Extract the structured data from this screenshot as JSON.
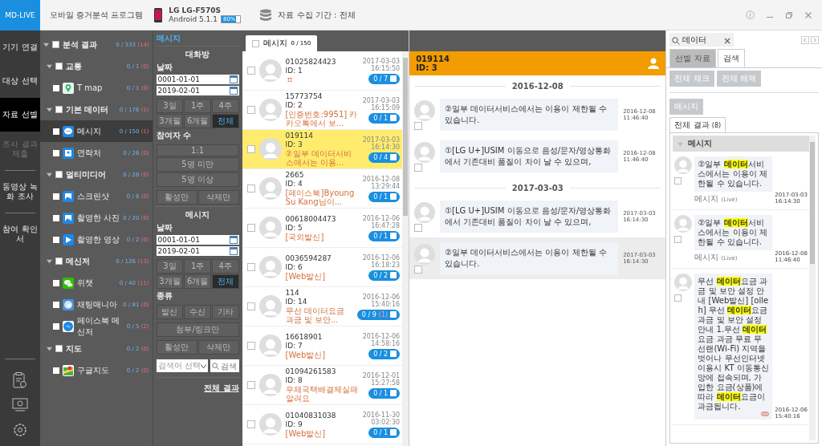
{
  "header": {
    "logo": "MD-LIVE",
    "title": "모바일 증거분석 프로그램",
    "device_name": "LG LG-F570S",
    "os": "Android 5.1.1",
    "battery": "80%",
    "period": "자료 수집 기간 : 전체"
  },
  "nav": {
    "steps": [
      {
        "label": "기기 연결",
        "selected": false,
        "disabled": false
      },
      {
        "label": "대상 선택",
        "selected": false,
        "disabled": false
      },
      {
        "label": "자료 선별",
        "selected": true,
        "disabled": false
      },
      {
        "label": "조사 결과 제출",
        "selected": false,
        "disabled": true
      }
    ],
    "tools": [
      "동영상 녹화 조사",
      "참여 확인서"
    ]
  },
  "tree": {
    "label": "분석 결과",
    "count": "0 / 333",
    "flag": "(14)",
    "expanded": true,
    "checked": false,
    "children": [
      {
        "label": "교통",
        "count": "0 / 1",
        "flag": "(0)",
        "expanded": true,
        "checked": false,
        "children": [
          {
            "label": "T map",
            "count": "0 / 1",
            "flag": "(0)",
            "kind": "pin",
            "selected": false
          }
        ]
      },
      {
        "label": "기본 데이터",
        "count": "0 / 176",
        "flag": "(1)",
        "expanded": true,
        "checked": false,
        "children": [
          {
            "label": "메시지",
            "count": "0 / 150",
            "flag": "(1)",
            "kind": "chat",
            "selected": true
          },
          {
            "label": "연락처",
            "count": "0 / 26",
            "flag": "(0)",
            "kind": "contact",
            "selected": false
          }
        ]
      },
      {
        "label": "멀티미디어",
        "count": "0 / 28",
        "flag": "(0)",
        "expanded": true,
        "checked": false,
        "children": [
          {
            "label": "스크린샷",
            "count": "0 / 6",
            "flag": "(0)",
            "kind": "image",
            "selected": false
          },
          {
            "label": "촬영한 사진",
            "count": "0 / 20",
            "flag": "(0)",
            "kind": "image",
            "selected": false
          },
          {
            "label": "촬영한 영상",
            "count": "0 / 2",
            "flag": "(0)",
            "kind": "play",
            "selected": false
          }
        ]
      },
      {
        "label": "메신저",
        "count": "0 / 126",
        "flag": "(13)",
        "expanded": true,
        "checked": false,
        "children": [
          {
            "label": "위챗",
            "count": "0 / 40",
            "flag": "(11)",
            "kind": "wechat",
            "selected": false
          },
          {
            "label": "채팅매니아",
            "count": "0 / 81",
            "flag": "(0)",
            "kind": "bubble",
            "selected": false
          },
          {
            "label": "페이스북 메신저",
            "count": "0 / 5",
            "flag": "(2)",
            "kind": "messenger",
            "selected": false
          }
        ]
      },
      {
        "label": "지도",
        "count": "0 / 2",
        "flag": "(0)",
        "expanded": true,
        "checked": false,
        "children": [
          {
            "label": "구글지도",
            "count": "0 / 2",
            "flag": "(0)",
            "kind": "map",
            "selected": false
          }
        ]
      }
    ]
  },
  "filter": {
    "title": "메시지",
    "sections": [
      {
        "heading": "대화방",
        "date_label": "날짜",
        "date_from": "0001-01-01",
        "date_to": "2019-02-01",
        "ranges": [
          {
            "label": "3일",
            "selected": false
          },
          {
            "label": "1주",
            "selected": false
          },
          {
            "label": "4주",
            "selected": false
          },
          {
            "label": "3개월",
            "selected": false
          },
          {
            "label": "6개월",
            "selected": false
          },
          {
            "label": "전체",
            "selected": true
          }
        ],
        "blocks": [
          {
            "label": "참여자 수",
            "rows": [
              [
                "1:1"
              ],
              [
                "5명 미만"
              ],
              [
                "5명 이상"
              ]
            ]
          },
          {
            "rows": [
              [
                "활성만",
                "삭제만"
              ]
            ]
          }
        ]
      },
      {
        "heading": "메시지",
        "date_label": "날짜",
        "date_from": "0001-01-01",
        "date_to": "2019-02-01",
        "ranges": [
          {
            "label": "3일",
            "selected": false
          },
          {
            "label": "1주",
            "selected": false
          },
          {
            "label": "4주",
            "selected": false
          },
          {
            "label": "3개월",
            "selected": false
          },
          {
            "label": "6개월",
            "selected": false
          },
          {
            "label": "전체",
            "selected": true
          }
        ],
        "blocks": [
          {
            "label": "종류",
            "rows": [
              [
                "발신",
                "수신",
                "기타"
              ]
            ]
          },
          {
            "rows": [
              [
                "첨부/링크만"
              ]
            ]
          },
          {
            "rows": [
              [
                "활성만",
                "삭제만"
              ]
            ]
          }
        ]
      }
    ],
    "keyword_select": "검색어 선택",
    "search_placeholder": "검색",
    "all_results": "전체 결과"
  },
  "list": {
    "tab": {
      "label": "메시지",
      "count": "0 / 150",
      "checked": false
    },
    "rows": [
      {
        "number": "01025824423",
        "id": "ID: 1",
        "preview": "ㅍ",
        "date": "2017-03-03",
        "time": "16:15:50",
        "badge": "0 / 7",
        "selected": false
      },
      {
        "number": "15773754",
        "id": "ID: 2",
        "preview": "[인증번호:9951] 카카오톡에서 보...",
        "date": "2017-03-03",
        "time": "16:15:09",
        "badge": "0 / 1",
        "selected": false
      },
      {
        "number": "019114",
        "id": "ID: 3",
        "preview": "②일부 데이터서비스에서는 이용...",
        "date": "2017-03-03",
        "time": "16:14:30",
        "badge": "0 / 4",
        "selected": true
      },
      {
        "number": "2665",
        "id": "ID: 4",
        "preview": "[페이스북]Byoung Su Kang님이...",
        "date": "2016-12-08",
        "time": "13:29:44",
        "badge": "0 / 1",
        "selected": false
      },
      {
        "number": "00618004473",
        "id": "ID: 5",
        "preview": "[국외발신]",
        "date": "2016-12-06",
        "time": "16:47:28",
        "badge": "0 / 1",
        "selected": false
      },
      {
        "number": "0036594287",
        "id": "ID: 6",
        "preview": "[Web발신]",
        "date": "2016-12-06",
        "time": "16:18:23",
        "badge": "0 / 2",
        "selected": false
      },
      {
        "number": "114",
        "id": "ID: 14",
        "preview": "무선 데이터요금 과금 및 보안...",
        "date": "2016-12-06",
        "time": "15:40:16",
        "badge": "0 / 9",
        "flag": "(1)",
        "selected": false
      },
      {
        "number": "16618901",
        "id": "ID: 7",
        "preview": "[Web발신]",
        "date": "2016-12-06",
        "time": "14:58:16",
        "badge": "0 / 2",
        "selected": false
      },
      {
        "number": "01094261583",
        "id": "ID: 8",
        "preview": "우체국택배결제실패알려요",
        "date": "2016-12-01",
        "time": "15:27:58",
        "badge": "0 / 1",
        "selected": false
      },
      {
        "number": "01040831038",
        "id": "ID: 9",
        "preview": "[Web발신]",
        "date": "2016-11-30",
        "time": "03:02:30",
        "badge": "0 / 1",
        "selected": false
      }
    ]
  },
  "conversation": {
    "number": "019114",
    "id": "ID: 3",
    "timeline": [
      {
        "kind": "date",
        "text": "2016-12-08"
      },
      {
        "kind": "message",
        "text": "②일부 데이터서비스에서는 이용이 제한될 수 있습니다.",
        "date": "2016-12-08",
        "time": "11:46:40",
        "selected": false
      },
      {
        "kind": "message",
        "text": "①[LG U+]USIM 이동으로 음성/문자/영상통화에서 기존대비 품질이 차이 날 수 있으며,",
        "date": "2016-12-08",
        "time": "11:46:40",
        "selected": false
      },
      {
        "kind": "date",
        "text": "2017-03-03"
      },
      {
        "kind": "message",
        "text": "①[LG U+]USIM 이동으로 음성/문자/영상통화에서 기존대비 품질이 차이 날 수 있으며,",
        "date": "2017-03-03",
        "time": "16:14:30",
        "selected": false
      },
      {
        "kind": "message",
        "text": "②일부 데이터서비스에서는 이용이 제한될 수 있습니다.",
        "date": "2017-03-03",
        "time": "16:14:30",
        "selected": true
      }
    ]
  },
  "search_panel": {
    "query": "데이터",
    "tabs": [
      {
        "label": "선별 자료",
        "selected": false
      },
      {
        "label": "검색",
        "selected": true
      }
    ],
    "actions": [
      "전체 체크",
      "전체 해제"
    ],
    "category": "메시지",
    "result_tab": {
      "label": "전체 결과",
      "count": "(8)"
    },
    "group": {
      "label": "메시지",
      "expanded": true
    },
    "results": [
      {
        "text": "②일부 **데이터**서비스에서는 이용이 제한될 수 있습니다.",
        "date": "2017-03-03",
        "time": "16:14:30",
        "source": "메시지",
        "source_note": "(Live)",
        "more": false,
        "checked": false
      },
      {
        "text": "②일부 **데이터**서비스에서는 이용이 제한될 수 있습니다.",
        "date": "2016-12-08",
        "time": "11:46:40",
        "source": "메시지",
        "source_note": "(Live)",
        "more": false,
        "checked": false
      },
      {
        "text": "무선 **데이터**요금 과금 및 보안 설정 안내 [Web발신] [olleh] 무선 **데이터**요금 과금 및 보안 설정안내 1.무선 **데이터**요금 과금 무료 무선랜(Wi-Fi) 지역을 벗어나 무선인터넷 이용시 KT 이동통신망에 접속되며, 가입한 요금(상품)에 따라 **데이터**요금이 과금됩니다.",
        "date": "2016-12-06",
        "time": "15:40:16",
        "more": true,
        "checked": false
      }
    ]
  }
}
